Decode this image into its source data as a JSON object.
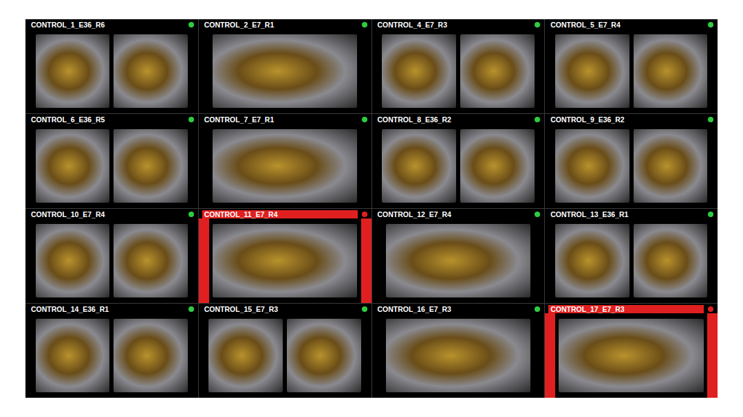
{
  "tiles": [
    {
      "label": "CONTROL_1_E36_R6",
      "ok": true,
      "color": "#2ecc40",
      "kind": "pair"
    },
    {
      "label": "CONTROL_2_E7_R1",
      "ok": true,
      "color": "#2ecc40",
      "kind": "single"
    },
    {
      "label": "CONTROL_4_E7_R3",
      "ok": true,
      "color": "#2ecc40",
      "kind": "pair"
    },
    {
      "label": "CONTROL_5_E7_R4",
      "ok": true,
      "color": "#2ecc40",
      "kind": "pair"
    },
    {
      "label": "CONTROL_6_E36_R5",
      "ok": true,
      "color": "#2ecc40",
      "kind": "pair"
    },
    {
      "label": "CONTROL_7_E7_R1",
      "ok": true,
      "color": "#2ecc40",
      "kind": "single"
    },
    {
      "label": "CONTROL_8_E36_R2",
      "ok": true,
      "color": "#2ecc40",
      "kind": "pair"
    },
    {
      "label": "CONTROL_9_E36_R2",
      "ok": true,
      "color": "#2ecc40",
      "kind": "pair"
    },
    {
      "label": "CONTROL_10_E7_R4",
      "ok": true,
      "color": "#2ecc40",
      "kind": "pair"
    },
    {
      "label": "CONTROL_11_E7_R4",
      "ok": false,
      "color": "#e02020",
      "kind": "single"
    },
    {
      "label": "CONTROL_12_E7_R4",
      "ok": true,
      "color": "#2ecc40",
      "kind": "single"
    },
    {
      "label": "CONTROL_13_E36_R1",
      "ok": true,
      "color": "#2ecc40",
      "kind": "pair"
    },
    {
      "label": "CONTROL_14_E36_R1",
      "ok": true,
      "color": "#2ecc40",
      "kind": "pair"
    },
    {
      "label": "CONTROL_15_E7_R3",
      "ok": true,
      "color": "#2ecc40",
      "kind": "pair"
    },
    {
      "label": "CONTROL_16_E7_R3",
      "ok": true,
      "color": "#2ecc40",
      "kind": "single"
    },
    {
      "label": "CONTROL_17_E7_R3",
      "ok": false,
      "color": "#e02020",
      "kind": "single"
    }
  ]
}
